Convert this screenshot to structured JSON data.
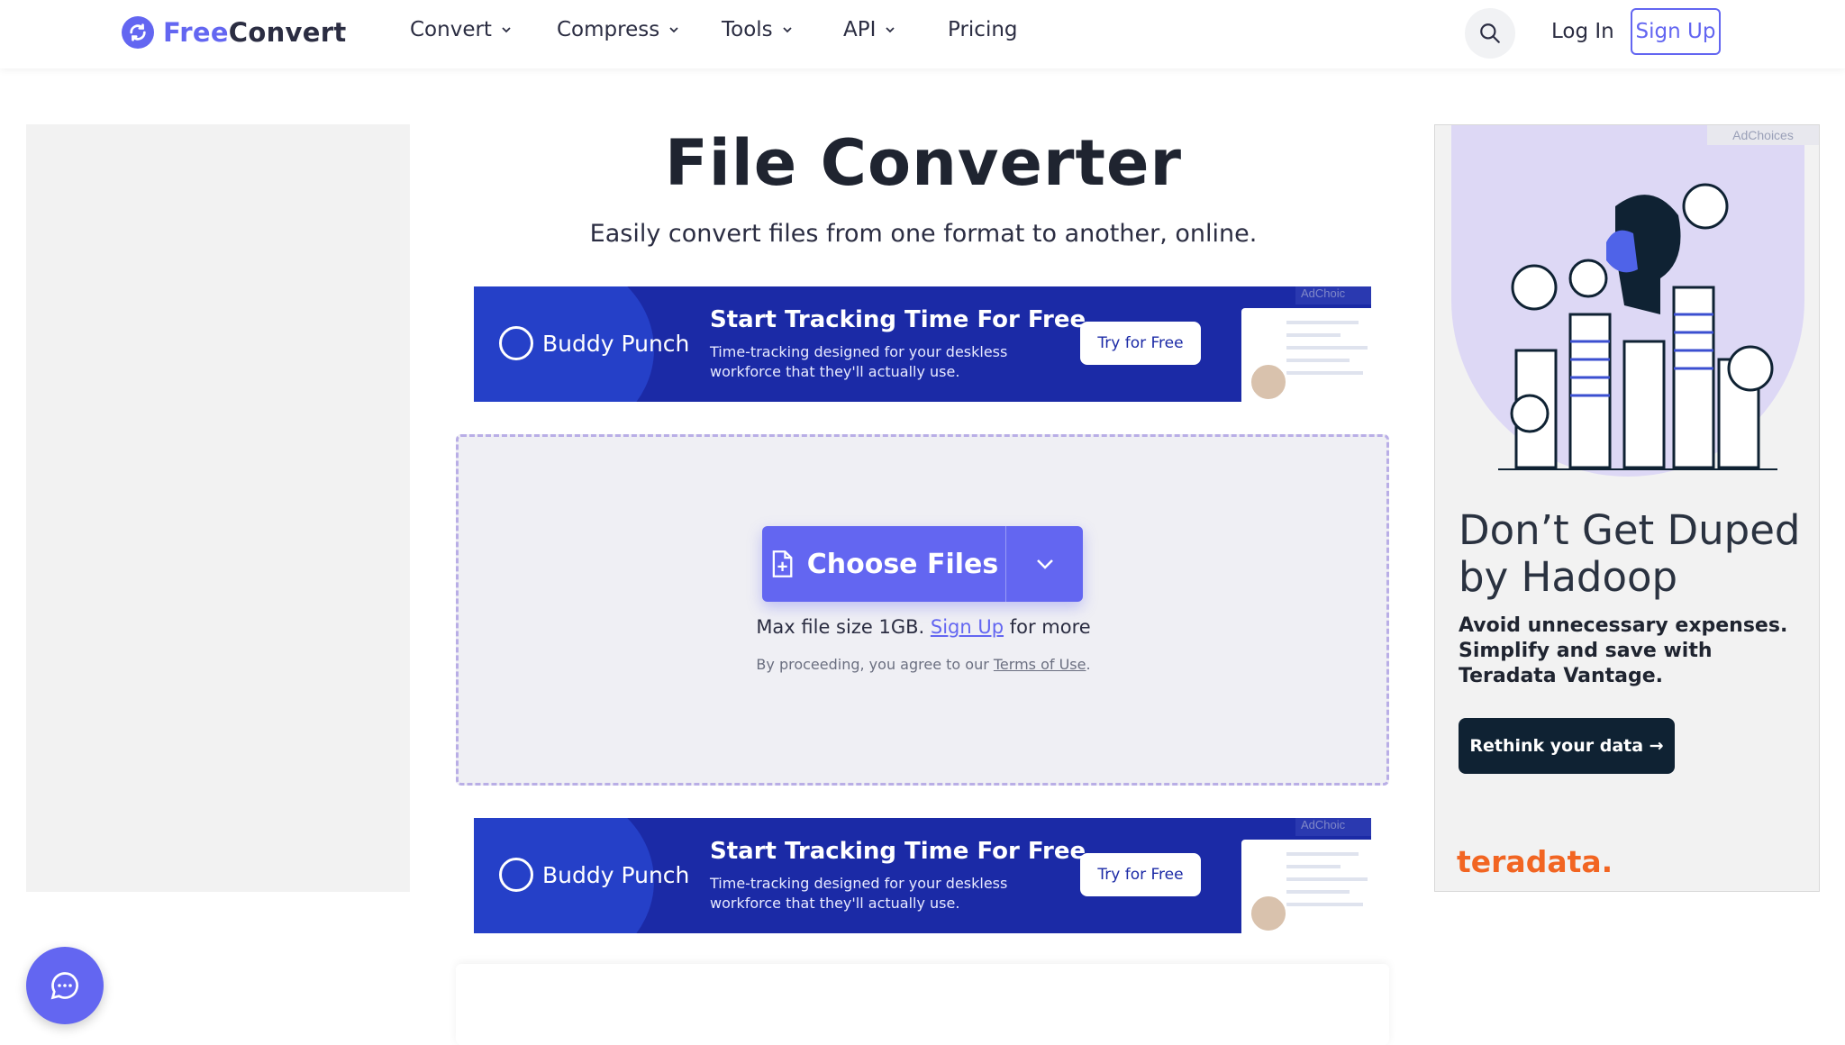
{
  "header": {
    "logo": {
      "free": "Free",
      "convert": "Convert"
    },
    "nav": [
      {
        "label": "Convert",
        "has_dropdown": true
      },
      {
        "label": "Compress",
        "has_dropdown": true
      },
      {
        "label": "Tools",
        "has_dropdown": true
      },
      {
        "label": "API",
        "has_dropdown": true
      },
      {
        "label": "Pricing",
        "has_dropdown": false
      }
    ],
    "login": "Log In",
    "signup": "Sign Up"
  },
  "main": {
    "title": "File Converter",
    "subtitle": "Easily convert files from one format to another, online.",
    "choose_files": "Choose Files",
    "max_size_prefix": "Max file size 1GB.",
    "max_size_link": "Sign Up",
    "max_size_suffix": "for more",
    "terms_prefix": "By proceeding, you agree to our",
    "terms_link": "Terms of Use",
    "terms_suffix": "."
  },
  "banner_ad": {
    "brand": "Buddy Punch",
    "headline": "Start Tracking Time For Free",
    "sub": "Time-tracking designed for your deskless workforce that they'll actually use.",
    "cta": "Try for Free",
    "adchoices": "AdChoic"
  },
  "side_ad": {
    "adchoices": "AdChoices",
    "headline": "Don’t Get Duped by Hadoop",
    "body": "Avoid unnecessary expenses. Simplify and save with Teradata Vantage.",
    "cta": "Rethink your data →",
    "brand": "teradata."
  },
  "colors": {
    "accent": "#6366f1",
    "ad_blue": "#1b2aa6",
    "teradata_orange": "#f26522"
  }
}
